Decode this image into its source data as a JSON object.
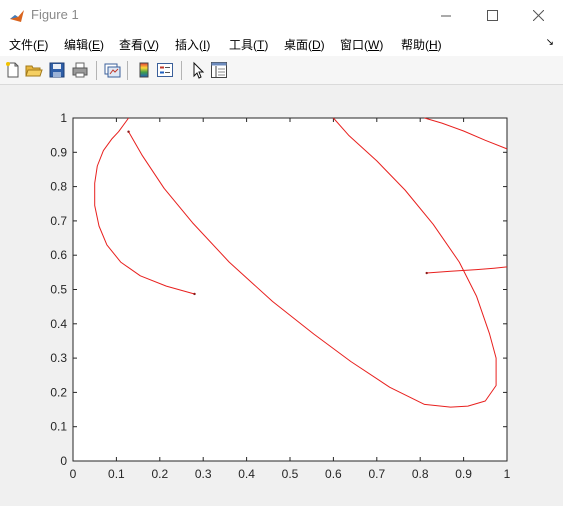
{
  "window": {
    "title": "Figure 1",
    "app_icon": "matlab-icon",
    "controls": [
      "minimize-icon",
      "maximize-icon",
      "close-icon"
    ]
  },
  "menu": {
    "items": [
      {
        "label": "文件(",
        "key": "F",
        "end": ")"
      },
      {
        "label": "编辑(",
        "key": "E",
        "end": ")"
      },
      {
        "label": "查看(",
        "key": "V",
        "end": ")"
      },
      {
        "label": "插入(",
        "key": "I",
        "end": ")"
      },
      {
        "label": "工具(",
        "key": "T",
        "end": ")"
      },
      {
        "label": "桌面(",
        "key": "D",
        "end": ")"
      },
      {
        "label": "窗口(",
        "key": "W",
        "end": ")"
      },
      {
        "label": "帮助(",
        "key": "H",
        "end": ")"
      }
    ],
    "overflow_icon": "dock-arrow-icon"
  },
  "toolbar": {
    "icons": [
      "new-figure-icon",
      "open-file-icon",
      "save-icon",
      "print-icon",
      "link-plot-icon",
      "insert-colorbar-icon",
      "insert-legend-icon",
      "pointer-icon",
      "property-editor-icon"
    ]
  },
  "chart_data": {
    "type": "line",
    "title": "",
    "xlabel": "",
    "ylabel": "",
    "xlim": [
      0,
      1
    ],
    "ylim": [
      0,
      1
    ],
    "xticks": [
      "0",
      "0.1",
      "0.2",
      "0.3",
      "0.4",
      "0.5",
      "0.6",
      "0.7",
      "0.8",
      "0.9",
      "1"
    ],
    "yticks": [
      "0",
      "0.1",
      "0.2",
      "0.3",
      "0.4",
      "0.5",
      "0.6",
      "0.7",
      "0.8",
      "0.9",
      "1"
    ],
    "grid": false,
    "color": "#e8201e",
    "series": [
      {
        "x": [
          0.28,
          0.215,
          0.155,
          0.11,
          0.078,
          0.06,
          0.05,
          0.05,
          0.056,
          0.07,
          0.09,
          0.105,
          0.128
        ],
        "y": [
          0.487,
          0.51,
          0.54,
          0.58,
          0.63,
          0.685,
          0.745,
          0.81,
          0.86,
          0.905,
          0.94,
          0.96,
          1.0
        ]
      },
      {
        "x": [
          0.128,
          0.16,
          0.21,
          0.275,
          0.36,
          0.46,
          0.555,
          0.64,
          0.73,
          0.81,
          0.87,
          0.91,
          0.95,
          0.975,
          0.975,
          0.96,
          0.93,
          0.89,
          0.83,
          0.765,
          0.7,
          0.635,
          0.6
        ],
        "y": [
          0.96,
          0.89,
          0.795,
          0.695,
          0.58,
          0.465,
          0.37,
          0.29,
          0.215,
          0.165,
          0.157,
          0.16,
          0.175,
          0.22,
          0.3,
          0.37,
          0.48,
          0.58,
          0.69,
          0.79,
          0.875,
          0.95,
          1.0
        ]
      },
      {
        "x": [
          0.81,
          0.85,
          0.9,
          0.95,
          1.0
        ],
        "y": [
          1.0,
          0.985,
          0.962,
          0.935,
          0.91
        ]
      },
      {
        "x": [
          0.815,
          0.87,
          0.93,
          0.97,
          1.0
        ],
        "y": [
          0.548,
          0.553,
          0.558,
          0.562,
          0.566
        ]
      }
    ]
  }
}
